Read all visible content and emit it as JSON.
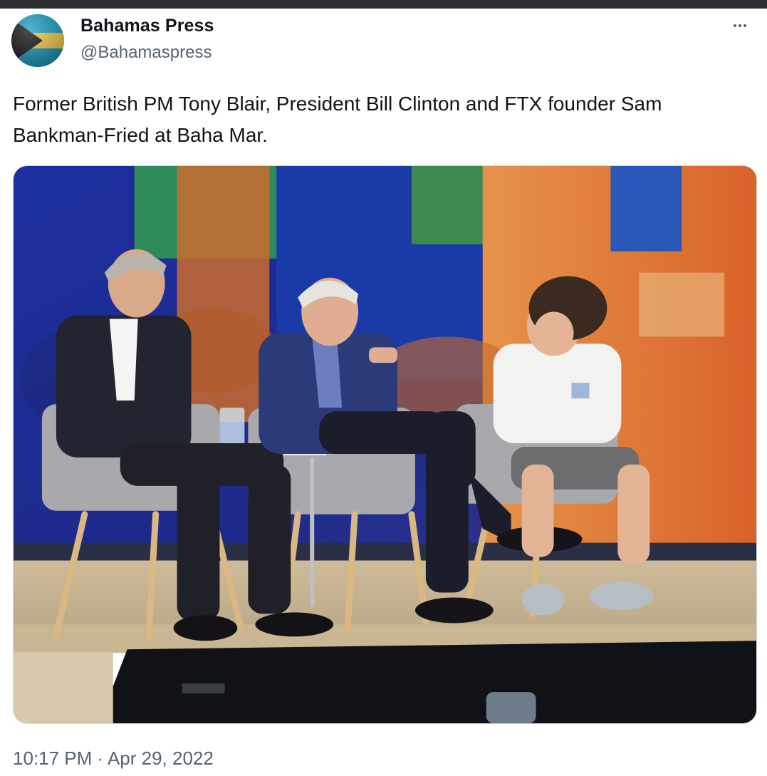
{
  "tweet": {
    "author_name": "Bahamas Press",
    "author_handle": "@Bahamaspress",
    "text": "Former British PM Tony Blair, President Bill Clinton and FTX founder Sam Bankman-Fried at Baha Mar.",
    "timestamp": "10:17 PM · Apr 29, 2022"
  },
  "icons": {
    "avatar": "bahamas-flag-avatar",
    "more": "more-options-icon"
  },
  "colors": {
    "name": "#0f1419",
    "secondary": "#536471",
    "flag_aqua": "#00abc9",
    "flag_gold": "#fae042",
    "flag_black": "#000000"
  }
}
